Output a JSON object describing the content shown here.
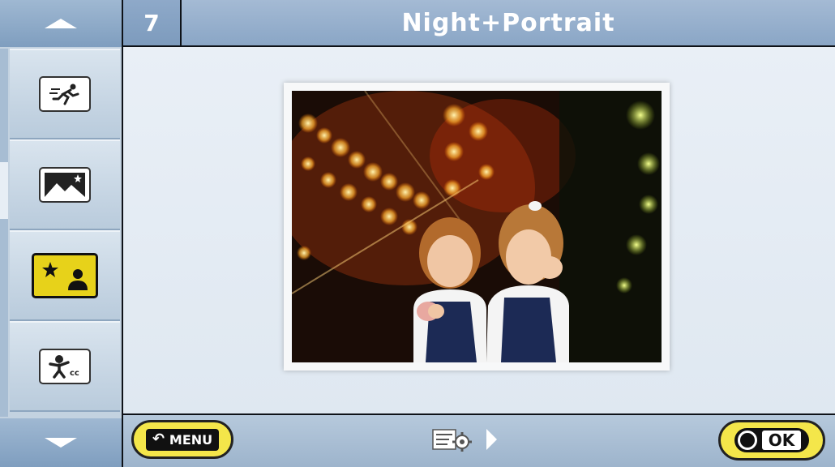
{
  "header": {
    "number": "7",
    "title": "Night+Portrait"
  },
  "sidebar": {
    "scroll_up_icon": "triangle-up-icon",
    "scroll_down_icon": "triangle-down-icon",
    "modes": [
      {
        "icon": "sports-runner-icon",
        "selected": false
      },
      {
        "icon": "night-landscape-icon",
        "selected": false
      },
      {
        "icon": "night-portrait-icon",
        "selected": true
      },
      {
        "icon": "children-icon",
        "selected": false
      }
    ]
  },
  "preview": {
    "image": "sample-photo-two-girls-night-lights"
  },
  "footer": {
    "menu_label": "MENU",
    "ok_label": "OK",
    "settings_icon": "settings-list-gear-icon",
    "next_icon": "triangle-right-icon"
  },
  "colors": {
    "accent_yellow": "#f4e64a",
    "header_blue": "#8aa6c6",
    "panel_light": "#e5ecf3"
  }
}
